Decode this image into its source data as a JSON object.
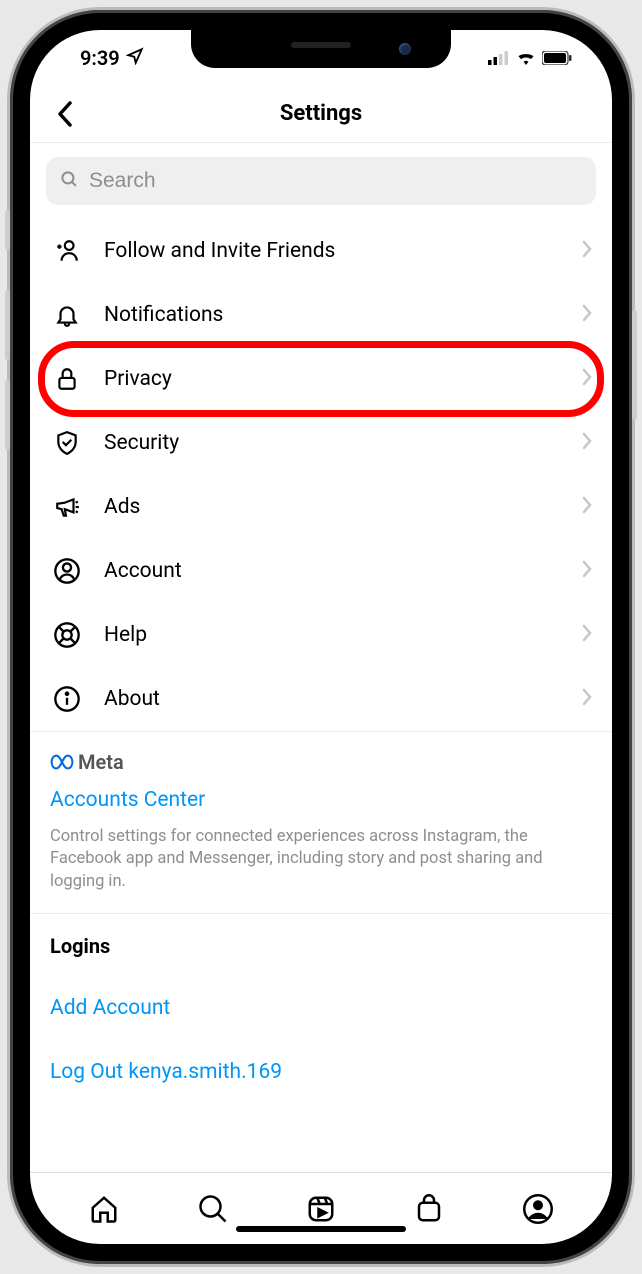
{
  "status": {
    "time": "9:39"
  },
  "header": {
    "title": "Settings"
  },
  "search": {
    "placeholder": "Search"
  },
  "menu": {
    "items": [
      {
        "id": "follow",
        "label": "Follow and Invite Friends"
      },
      {
        "id": "notifications",
        "label": "Notifications"
      },
      {
        "id": "privacy",
        "label": "Privacy",
        "highlighted": true
      },
      {
        "id": "security",
        "label": "Security"
      },
      {
        "id": "ads",
        "label": "Ads"
      },
      {
        "id": "account",
        "label": "Account"
      },
      {
        "id": "help",
        "label": "Help"
      },
      {
        "id": "about",
        "label": "About"
      }
    ]
  },
  "meta": {
    "brand": "Meta",
    "accounts_center": "Accounts Center",
    "description": "Control settings for connected experiences across Instagram, the Facebook app and Messenger, including story and post sharing and logging in."
  },
  "logins": {
    "title": "Logins",
    "add_account": "Add Account",
    "logout": "Log Out kenya.smith.169"
  }
}
